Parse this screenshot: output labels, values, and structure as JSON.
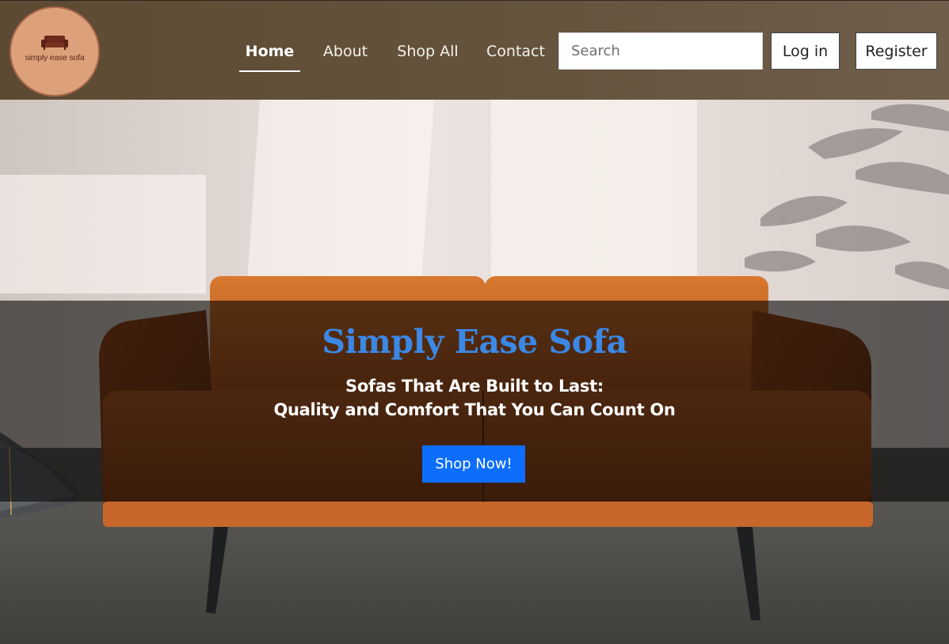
{
  "logo": {
    "text": "simply ease sofa",
    "icon": "sofa-icon",
    "bg_color": "#dca17a"
  },
  "nav": {
    "items": [
      {
        "label": "Home",
        "active": true
      },
      {
        "label": "About",
        "active": false
      },
      {
        "label": "Shop All",
        "active": false
      },
      {
        "label": "Contact",
        "active": false
      }
    ]
  },
  "search": {
    "placeholder": "Search",
    "value": ""
  },
  "auth": {
    "login_label": "Log in",
    "register_label": "Register"
  },
  "hero": {
    "title": "Simply Ease Sofa",
    "subtitle_line1": "Sofas That Are Built to Last:",
    "subtitle_line2": "Quality and Comfort That You Can Count On",
    "cta_label": "Shop Now!"
  },
  "colors": {
    "header_bg": "#64533d",
    "accent_title": "#3b88e6",
    "cta_bg": "#0d6efd"
  }
}
